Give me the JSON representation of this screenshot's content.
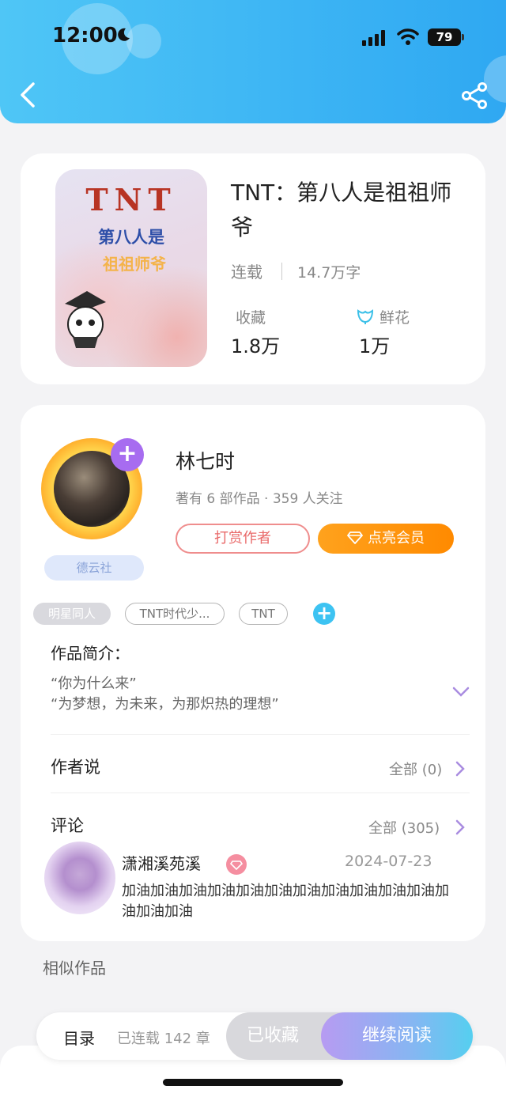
{
  "status_bar": {
    "time": "12:00",
    "battery": "79"
  },
  "book": {
    "cover": {
      "title": "TNT",
      "subtitle_line1": "第八人是",
      "subtitle_line2": "祖祖师爷"
    },
    "title": "TNT：第八人是祖祖师爷",
    "status": "连载",
    "word_count": "14.7万字",
    "stats": [
      {
        "label": "收藏",
        "value": "1.8万"
      },
      {
        "label": "鲜花",
        "value": "1万"
      }
    ]
  },
  "author": {
    "name": "林七时",
    "meta": "著有 6 部作品 · 359 人关注",
    "badge": "德云社",
    "tip_button": "打赏作者",
    "vip_button": "点亮会员"
  },
  "tags": [
    "明星同人",
    "TNT时代少...",
    "TNT"
  ],
  "intro": {
    "title": "作品简介：",
    "lines": [
      "“你为什么来”",
      "“为梦想，为未来，为那炽热的理想”"
    ]
  },
  "author_says": {
    "title": "作者说",
    "all": "全部 (0)"
  },
  "comments": {
    "title": "评论",
    "all": "全部 (305)",
    "items": [
      {
        "user": "潇湘溪苑溪",
        "date": "2024-07-23",
        "text": "加油加油加油加油加油加油加油加油加油加油加油加油加油加油"
      }
    ]
  },
  "similar": {
    "title": "相似作品"
  },
  "bottom_bar": {
    "toc_label": "目录",
    "chapter_count": "已连载 142 章",
    "collected": "已收藏",
    "continue": "继续阅读"
  },
  "colors": {
    "header": "#2fa8f2",
    "vip": "#ff8a00",
    "tip": "#e96a6a",
    "plus": "#a76cf0",
    "tag_plus": "#3dc3f2"
  }
}
